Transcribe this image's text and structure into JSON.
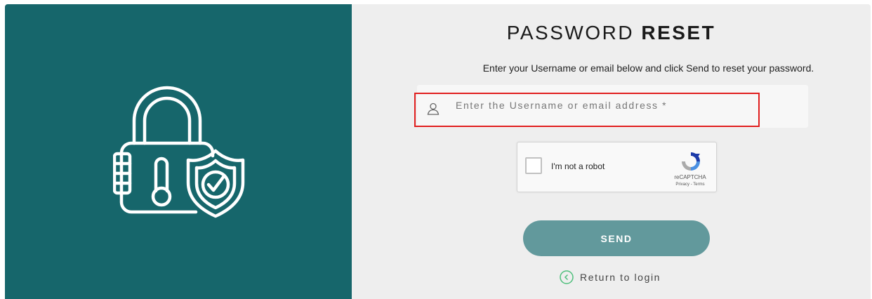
{
  "left_panel": {
    "illustration_icon": "padlock-with-shield-check-icon",
    "background_color": "#16666b"
  },
  "form": {
    "title_light": "PASSWORD",
    "title_bold": "RESET",
    "subtitle": "Enter your Username or email below and click Send to reset your password.",
    "username_input": {
      "icon": "user-icon",
      "placeholder": "Enter the Username or email address *",
      "value": ""
    },
    "recaptcha": {
      "label": "I'm not a robot",
      "brand": "reCAPTCHA",
      "links": "Privacy - Terms",
      "checked": false
    },
    "send_button_label": "SEND",
    "return_link": {
      "icon": "chevron-left-circle-icon",
      "label": "Return to login"
    }
  },
  "colors": {
    "primary": "#16666b",
    "button": "#62999c",
    "highlight": "#e01e1e",
    "form_background": "#eeeeee"
  }
}
